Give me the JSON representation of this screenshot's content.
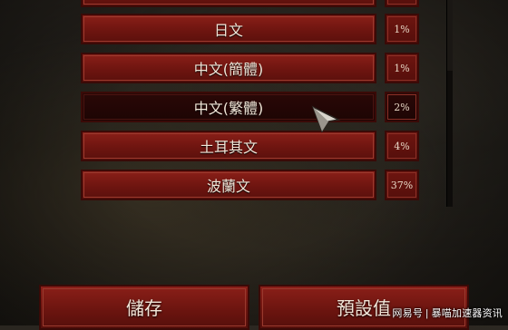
{
  "languages": [
    {
      "name": "日文",
      "percent": "1%"
    },
    {
      "name": "中文(簡體)",
      "percent": "1%"
    },
    {
      "name": "中文(繁體)",
      "percent": "2%"
    },
    {
      "name": "土耳其文",
      "percent": "4%"
    },
    {
      "name": "波蘭文",
      "percent": "37%"
    }
  ],
  "selected_language": "中文(繁體)",
  "footer": {
    "save_label": "儲存",
    "default_label": "預設值"
  },
  "watermark": "网易号 | 暴喵加速器资讯",
  "colors": {
    "button_red": "#7a1a14",
    "button_border": "#3a0a07",
    "selected_dark": "#230605",
    "text_cream": "#f2e6d8"
  },
  "icons": {
    "cursor": "pointer-arrow-icon"
  }
}
